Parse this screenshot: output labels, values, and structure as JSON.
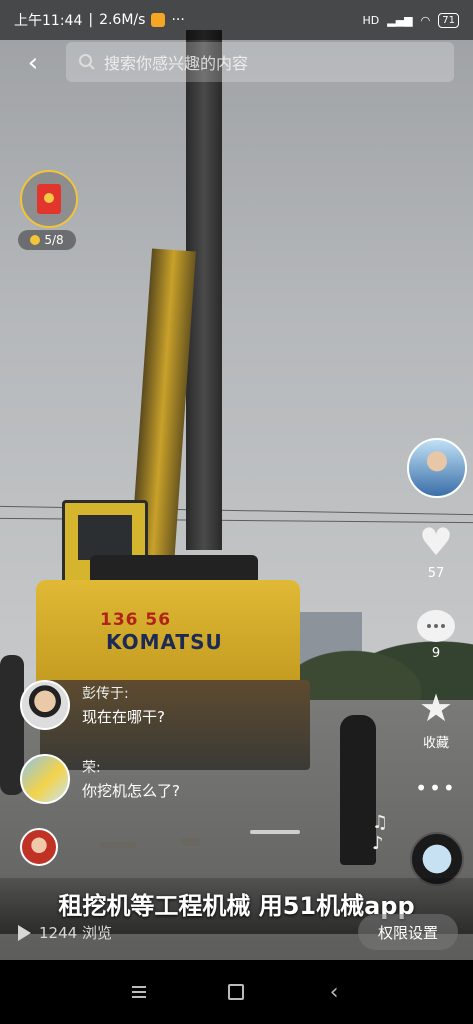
{
  "status_bar": {
    "time": "上午11:44",
    "speed": "2.6M/s",
    "more": "···",
    "network": "HD",
    "battery": "71"
  },
  "search": {
    "placeholder": "搜索你感兴趣的内容"
  },
  "task": {
    "progress": "5/8"
  },
  "video_scene": {
    "excavator_number": "136 56",
    "excavator_brand": "KOMATSU"
  },
  "actions": {
    "like_count": "57",
    "comment_count": "9",
    "favorite_label": "收藏",
    "more": "•••"
  },
  "comments": [
    {
      "name": "彭传于:",
      "text": "现在在哪干?"
    },
    {
      "name": "荣:",
      "text": "你挖机怎么了?"
    }
  ],
  "banner": {
    "text": "租挖机等工程机械  用51机械app"
  },
  "footer": {
    "views": "1244 浏览",
    "permission_button": "权限设置"
  },
  "icons": [
    "back-icon",
    "search-icon",
    "red-packet-icon",
    "coin-icon",
    "heart-icon",
    "comment-icon",
    "star-icon",
    "music-note-icon",
    "play-icon",
    "menu-icon",
    "home-icon",
    "nav-back-icon"
  ]
}
